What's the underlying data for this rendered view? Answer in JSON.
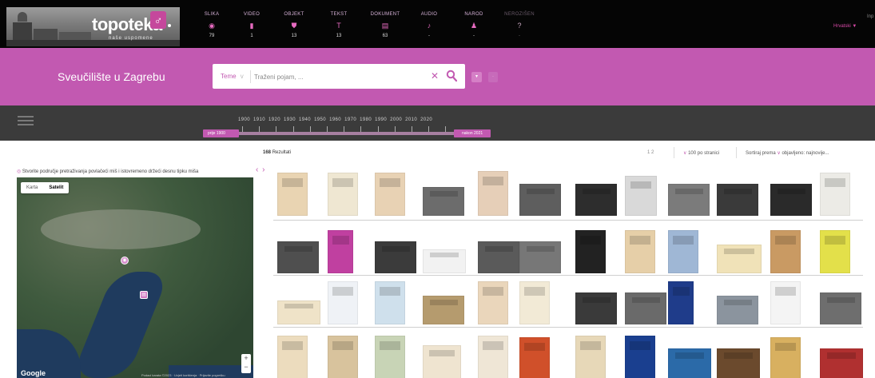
{
  "brand": {
    "name": "topoteka",
    "tagline": "naše uspomene"
  },
  "categories": [
    {
      "label": "SLIKA",
      "icon": "◉",
      "icon_name": "image-icon",
      "count": "79",
      "dim": false
    },
    {
      "label": "VIDEO",
      "icon": "▮",
      "icon_name": "video-icon",
      "count": "1",
      "dim": false
    },
    {
      "label": "OBJEKT",
      "icon": "⛊",
      "icon_name": "object-icon",
      "count": "13",
      "dim": false
    },
    {
      "label": "TEKST",
      "icon": "T",
      "icon_name": "text-icon",
      "count": "13",
      "dim": false
    },
    {
      "label": "DOKUMENT",
      "icon": "▤",
      "icon_name": "document-icon",
      "count": "63",
      "dim": false
    },
    {
      "label": "AUDIO",
      "icon": "♪",
      "icon_name": "audio-icon",
      "count": "-",
      "dim": false
    },
    {
      "label": "NAROD",
      "icon": "♟",
      "icon_name": "person-icon",
      "count": "-",
      "dim": false
    },
    {
      "label": "NEROZIŠEN",
      "icon": "?",
      "icon_name": "unknown-icon",
      "count": "-",
      "dim": true
    }
  ],
  "header": {
    "language": "Hrvatski",
    "language_icon": "▼",
    "right_edge_text": "Inp"
  },
  "topoteka_title": "Sveučilište u Zagrebu",
  "search": {
    "scope_label": "Teme",
    "scope_chevron": "v",
    "placeholder": "Traženi pojam, ...",
    "clear_symbol": "✕",
    "advanced_symbol": "▾",
    "extra_symbol": "·"
  },
  "timeline": {
    "decades": "1900 1910 1920 1930 1940 1950 1960 1970 1980 1990 2000 2010 2020",
    "before_label": "prije 1900",
    "after_label": "nakon 2021"
  },
  "results": {
    "count": "168",
    "count_label": "Rezultati",
    "pages": "1   2",
    "per_page": "100 po stranici",
    "sort_label": "Sortiraj prema",
    "sort_value": "objavljeno: najnovije..."
  },
  "map": {
    "hint": "Stvorite područje pretraživanja povlačeći miš i istovremeno držeći desnu tipku miša",
    "collapse_symbol": "‹ ›",
    "type_map": "Karta",
    "type_satellite": "Satelit",
    "zoom_in": "+",
    "zoom_out": "−",
    "google": "Google",
    "copyright": "Podaci karata ©2023 · Uvjeti korištenja · Prijavite pogrešku"
  },
  "colors": {
    "brand_pink": "#c259b1",
    "top_bar": "#050505",
    "timeline_bar": "#3b3b3b"
  },
  "thumbnail_rows": [
    [
      {
        "kind": "document-page",
        "color": "#e9d4b2"
      },
      {
        "kind": "document-page",
        "color": "#efe7d2"
      },
      {
        "kind": "document-page",
        "color": "#e8d2b4"
      },
      {
        "kind": "photo-building",
        "color": "#6c6c6c"
      },
      {
        "kind": "portrait-drawing",
        "color": "#e6cfb8"
      },
      {
        "kind": "photo-bw",
        "color": "#5e5e5e"
      },
      {
        "kind": "photo-bw",
        "color": "#2d2d2d"
      },
      {
        "kind": "newspaper",
        "color": "#d9d9d9"
      },
      {
        "kind": "photo-bw",
        "color": "#7b7b7b"
      },
      {
        "kind": "photo-bw",
        "color": "#3a3a3a"
      },
      {
        "kind": "photo-bw",
        "color": "#2a2a2a"
      },
      {
        "kind": "document-page",
        "color": "#ecebe6"
      }
    ],
    [
      {
        "kind": "photo-bw",
        "color": "#4f4f4f"
      },
      {
        "kind": "book-cover",
        "color": "#c040a0"
      },
      {
        "kind": "photo-bw",
        "color": "#3b3b3b"
      },
      {
        "kind": "logo-card",
        "color": "#f2f2f2"
      },
      {
        "kind": "photo-bw",
        "color": "#5a5a5a"
      },
      {
        "kind": "photo-bw",
        "color": "#777777"
      },
      {
        "kind": "poster",
        "color": "#222222"
      },
      {
        "kind": "document-page",
        "color": "#e6cfa8"
      },
      {
        "kind": "document-page",
        "color": "#9fb7d5"
      },
      {
        "kind": "postcard",
        "color": "#f0e2b8"
      },
      {
        "kind": "document-page",
        "color": "#c99a63"
      },
      {
        "kind": "poster",
        "color": "#e3e04a"
      }
    ],
    [
      {
        "kind": "handwriting",
        "color": "#efe3c8"
      },
      {
        "kind": "document-page",
        "color": "#eff2f6"
      },
      {
        "kind": "document-page",
        "color": "#cfe0ec"
      },
      {
        "kind": "photo-building",
        "color": "#b59b6e"
      },
      {
        "kind": "document-page",
        "color": "#ead6bb"
      },
      {
        "kind": "document-page",
        "color": "#f2ead6"
      },
      {
        "kind": "photo-bw",
        "color": "#3a3a3a"
      },
      {
        "kind": "photo-bw",
        "color": "#6a6a6a"
      },
      {
        "kind": "book-cover",
        "color": "#1f3c8a"
      },
      {
        "kind": "photo-building",
        "color": "#8b949e"
      },
      {
        "kind": "document-page",
        "color": "#f4f4f4"
      },
      {
        "kind": "photo-bw",
        "color": "#6e6e6e"
      }
    ],
    [
      {
        "kind": "document-page",
        "color": "#ecdcbe"
      },
      {
        "kind": "document-page",
        "color": "#d8c39d"
      },
      {
        "kind": "document-page",
        "color": "#c8d4b6"
      },
      {
        "kind": "certificate",
        "color": "#efe4d0"
      },
      {
        "kind": "document-page",
        "color": "#efe6d6"
      },
      {
        "kind": "object",
        "color": "#d0502a"
      },
      {
        "kind": "document-page",
        "color": "#e7d8b8"
      },
      {
        "kind": "poster",
        "color": "#1a3f8f"
      },
      {
        "kind": "photo-color",
        "color": "#2b6aa8"
      },
      {
        "kind": "photo-color",
        "color": "#6b4a2d"
      },
      {
        "kind": "object",
        "color": "#d8b060"
      },
      {
        "kind": "photo-color",
        "color": "#b03030"
      }
    ]
  ]
}
